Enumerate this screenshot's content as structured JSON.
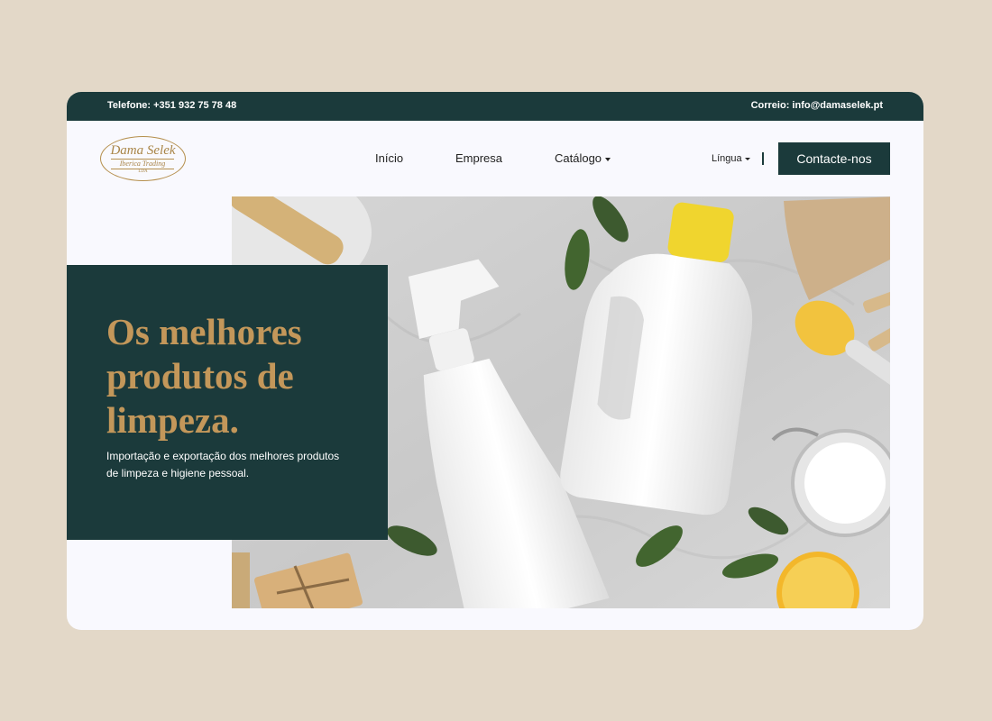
{
  "topbar": {
    "phone": "Telefone: +351 932 75 78 48",
    "email": "Correio: info@damaselek.pt"
  },
  "logo": {
    "name": "Dama Selek",
    "subtitle": "Iberica Trading",
    "suffix": "LDA"
  },
  "nav": {
    "items": [
      {
        "label": "Início"
      },
      {
        "label": "Empresa"
      },
      {
        "label": "Catálogo"
      }
    ],
    "language_label": "Língua",
    "cta_label": "Contacte-nos"
  },
  "hero": {
    "title": "Os melhores produtos de limpeza.",
    "subtitle": "Importação e exportação dos melhores produtos de limpeza e higiene pessoal."
  },
  "colors": {
    "page_background": "#e3d8c8",
    "card_background": "#f9f9fe",
    "brand_dark": "#1b3a3b",
    "brand_gold": "#c3975a"
  }
}
